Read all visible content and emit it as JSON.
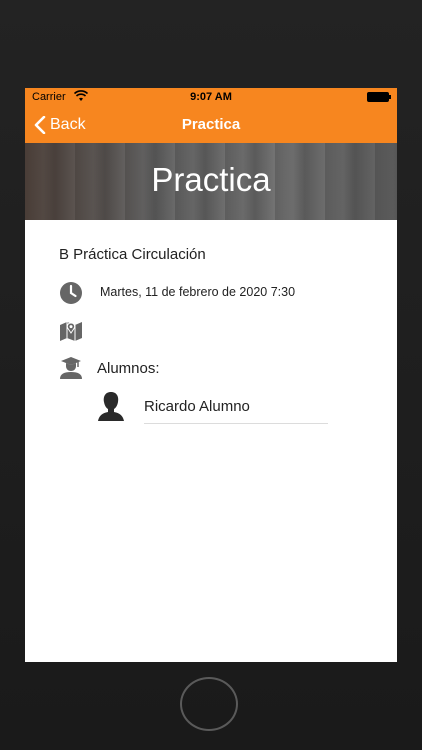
{
  "status": {
    "carrier": "Carrier",
    "time": "9:07 AM"
  },
  "nav": {
    "back_label": "Back",
    "title": "Practica"
  },
  "hero": {
    "title": "Practica"
  },
  "lesson": {
    "name": "B Práctica Circulación",
    "datetime": "Martes, 11 de febrero de 2020 7:30",
    "students_label": "Alumnos:",
    "students": [
      {
        "name": "Ricardo Alumno"
      }
    ]
  },
  "colors": {
    "accent": "#f7861f",
    "icon": "#666666"
  }
}
